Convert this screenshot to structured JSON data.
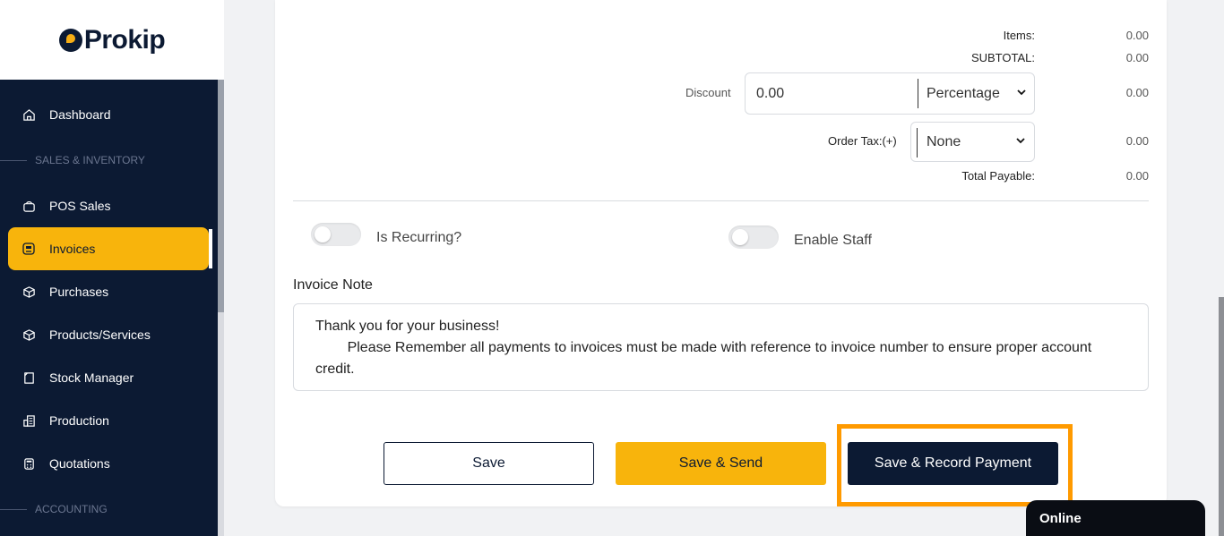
{
  "brand": {
    "name": "Prokip"
  },
  "sidebar": {
    "items": [
      {
        "label": "Dashboard",
        "icon": "home-icon"
      },
      {
        "label": "POS Sales",
        "icon": "shopping-bag-icon"
      },
      {
        "label": "Invoices",
        "icon": "invoice-icon",
        "active": true
      },
      {
        "label": "Purchases",
        "icon": "box-icon"
      },
      {
        "label": "Products/Services",
        "icon": "cube-icon"
      },
      {
        "label": "Stock Manager",
        "icon": "note-icon"
      },
      {
        "label": "Production",
        "icon": "building-icon"
      },
      {
        "label": "Quotations",
        "icon": "calculator-icon"
      }
    ],
    "sections": {
      "sales": "SALES & INVENTORY",
      "accounting": "ACCOUNTING"
    }
  },
  "summary": {
    "items_label": "Items:",
    "items_value": "0.00",
    "subtotal_label": "SUBTOTAL:",
    "subtotal_value": "0.00",
    "discount_label": "Discount",
    "discount_value": "0.00",
    "discount_type": "Percentage",
    "discount_amount": "0.00",
    "tax_label": "Order Tax:(+)",
    "tax_value": "None",
    "tax_amount": "0.00",
    "total_label": "Total Payable:",
    "total_value": "0.00"
  },
  "toggles": {
    "recurring": "Is Recurring?",
    "staff": "Enable Staff"
  },
  "note": {
    "label": "Invoice Note",
    "text": "Thank you for your business!\n        Please Remember all payments to invoices must be made with reference to invoice number to ensure proper account credit."
  },
  "buttons": {
    "save": "Save",
    "save_send": "Save & Send",
    "save_record": "Save & Record Payment"
  },
  "chat": {
    "status": "Online"
  },
  "colors": {
    "sidebar_bg": "#0c1a33",
    "accent": "#f8b40c",
    "highlight": "#ff9a00"
  }
}
